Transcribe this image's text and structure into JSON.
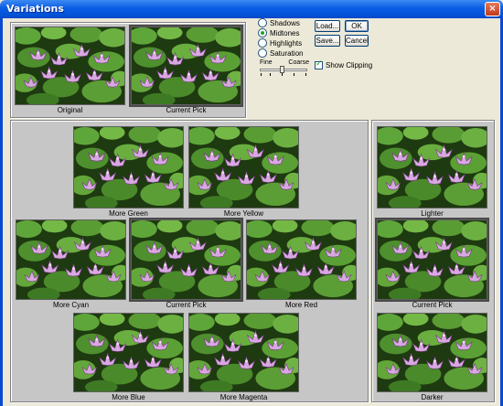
{
  "window": {
    "title": "Variations",
    "close_label": "×"
  },
  "top": {
    "original_label": "Original",
    "current_pick_label": "Current Pick"
  },
  "options": {
    "radios": [
      {
        "label": "Shadows",
        "selected": false
      },
      {
        "label": "Midtones",
        "selected": true
      },
      {
        "label": "Highlights",
        "selected": false
      },
      {
        "label": "Saturation",
        "selected": false
      }
    ],
    "fine_label": "Fine",
    "coarse_label": "Coarse",
    "show_clipping_label": "Show Clipping",
    "show_clipping_checked": true
  },
  "buttons": {
    "load": "Load...",
    "ok": "OK",
    "save": "Save...",
    "cancel": "Cancel"
  },
  "color_variations": {
    "more_green": "More Green",
    "more_yellow": "More Yellow",
    "more_cyan": "More Cyan",
    "current_pick": "Current Pick",
    "more_red": "More Red",
    "more_blue": "More Blue",
    "more_magenta": "More Magenta"
  },
  "brightness": {
    "lighter": "Lighter",
    "current_pick": "Current Pick",
    "darker": "Darker"
  },
  "colors": {
    "dialog_bg": "#ECE9D8",
    "panel_bg": "#C6C6C6",
    "titlebar": "#0A5DE5"
  }
}
